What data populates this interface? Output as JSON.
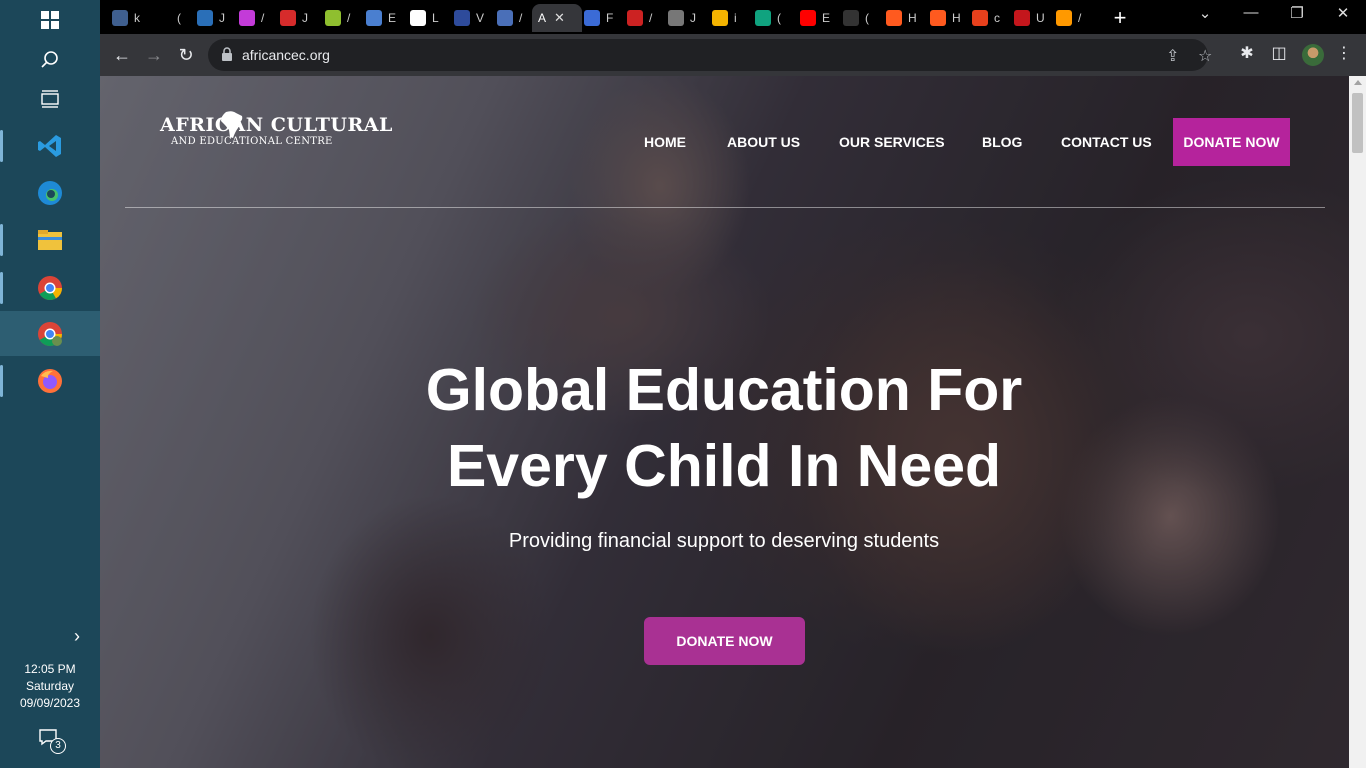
{
  "taskbar": {
    "icons": [
      "windows-start-icon",
      "search-icon",
      "task-view-icon",
      "vscode-icon",
      "edge-icon",
      "file-explorer-icon",
      "chrome-icon",
      "chrome-profile-icon",
      "firefox-icon"
    ],
    "clock_time": "12:05 PM",
    "clock_day": "Saturday",
    "clock_date": "09/09/2023",
    "notification_count": "3"
  },
  "browser": {
    "tabs": [
      {
        "label": "k",
        "color": "#3f5f8f"
      },
      {
        "label": "(",
        "color": "#000000"
      },
      {
        "label": "J",
        "color": "#2a6fb8"
      },
      {
        "label": "/",
        "color": "#c33bd8"
      },
      {
        "label": "J",
        "color": "#d62b2b"
      },
      {
        "label": "/",
        "color": "#8fbf2f"
      },
      {
        "label": "E",
        "color": "#4a7fd0"
      },
      {
        "label": "L",
        "color": "#ffffff"
      },
      {
        "label": "V",
        "color": "#2e4b9b"
      },
      {
        "label": "/",
        "color": "#4a6fb8"
      },
      {
        "label": "A",
        "color": "#35363a"
      },
      {
        "label": "F",
        "color": "#3b6bd6"
      },
      {
        "label": "/",
        "color": "#cc2222"
      },
      {
        "label": "J",
        "color": "#777777"
      },
      {
        "label": "i",
        "color": "#f4b400"
      },
      {
        "label": "(",
        "color": "#10a37f"
      },
      {
        "label": "E",
        "color": "#ff0000"
      },
      {
        "label": "(",
        "color": "#333333"
      },
      {
        "label": "H",
        "color": "#ff5a1f"
      },
      {
        "label": "H",
        "color": "#ff5a1f"
      },
      {
        "label": "c",
        "color": "#e8401c"
      },
      {
        "label": "U",
        "color": "#c4161c"
      },
      {
        "label": "/",
        "color": "#ff9900"
      }
    ],
    "active_tab_label": "A",
    "active_tab_close": "✕",
    "new_tab": "+",
    "window_minimize": "—",
    "window_restore": "❐",
    "window_close": "✕",
    "chevron_down": "⌄",
    "url": "africancec.org"
  },
  "site": {
    "logo_line1": "AFRICAN CULTURAL",
    "logo_line2": "AND EDUCATIONAL CENTRE",
    "nav": {
      "home": "HOME",
      "about": "ABOUT US",
      "services": "OUR SERVICES",
      "blog": "BLOG",
      "contact": "CONTACT US",
      "donate": "DONATE NOW"
    },
    "headline_line1": "Global Education For",
    "headline_line2": "Every Child In Need",
    "subheadline": "Providing financial support to deserving students",
    "cta": "DONATE NOW",
    "accent_color": "#b5239c"
  }
}
